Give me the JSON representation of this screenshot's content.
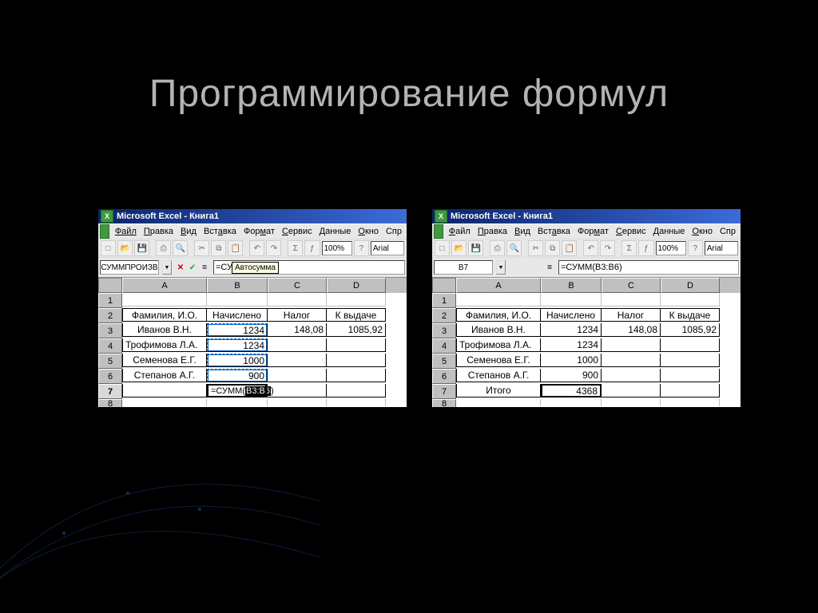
{
  "slide": {
    "title": "Программирование формул"
  },
  "excel": {
    "window_title": "Microsoft Excel - Книга1",
    "menu": [
      "Файл",
      "Правка",
      "Вид",
      "Вставка",
      "Формат",
      "Сервис",
      "Данные",
      "Окно",
      "Спр"
    ],
    "zoom": "100%",
    "font": "Arial",
    "tooltip": "Автосумма"
  },
  "left": {
    "name_box": "СУММПРОИЗВ",
    "formula_display": "=СУ",
    "rows": [
      {
        "n": "1",
        "A": "",
        "B": "",
        "C": "",
        "D": ""
      },
      {
        "n": "2",
        "A": "Фамилия, И.О.",
        "B": "Начислено",
        "C": "Налог",
        "D": "К выдаче"
      },
      {
        "n": "3",
        "A": "Иванов В.Н.",
        "B": "1234",
        "C": "148,08",
        "D": "1085,92"
      },
      {
        "n": "4",
        "A": "Трофимова Л.А.",
        "B": "1234",
        "C": "",
        "D": ""
      },
      {
        "n": "5",
        "A": "Семенова Е.Г.",
        "B": "1000",
        "C": "",
        "D": ""
      },
      {
        "n": "6",
        "A": "Степанов А.Г.",
        "B": "900",
        "C": "",
        "D": ""
      },
      {
        "n": "7",
        "A": "",
        "B_prefix": "=СУММ(",
        "B_sel": "B3:B6",
        "B_suffix": ")",
        "C": "",
        "D": ""
      }
    ]
  },
  "right": {
    "name_box": "B7",
    "formula": "=СУММ(B3:B6)",
    "rows": [
      {
        "n": "1",
        "A": "",
        "B": "",
        "C": "",
        "D": ""
      },
      {
        "n": "2",
        "A": "Фамилия, И.О.",
        "B": "Начислено",
        "C": "Налог",
        "D": "К выдаче"
      },
      {
        "n": "3",
        "A": "Иванов В.Н.",
        "B": "1234",
        "C": "148,08",
        "D": "1085,92"
      },
      {
        "n": "4",
        "A": "Трофимова Л.А.",
        "B": "1234",
        "C": "",
        "D": ""
      },
      {
        "n": "5",
        "A": "Семенова Е.Г.",
        "B": "1000",
        "C": "",
        "D": ""
      },
      {
        "n": "6",
        "A": "Степанов А.Г.",
        "B": "900",
        "C": "",
        "D": ""
      },
      {
        "n": "7",
        "A": "Итого",
        "B": "4368",
        "C": "",
        "D": ""
      }
    ]
  },
  "cols": [
    "A",
    "B",
    "C",
    "D"
  ]
}
